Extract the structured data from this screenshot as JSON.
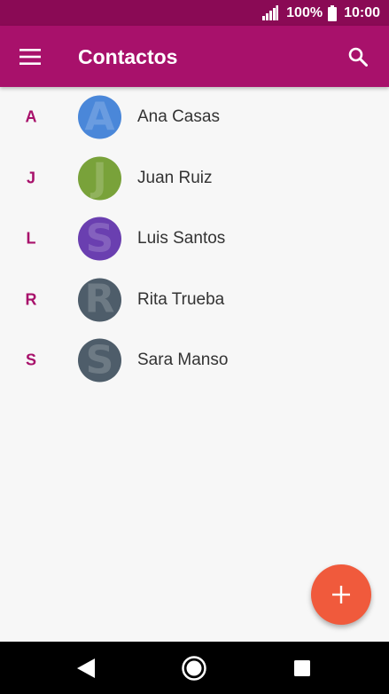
{
  "status_bar": {
    "battery_percent": "100%",
    "time": "10:00"
  },
  "app_bar": {
    "title": "Contactos",
    "menu_icon": "hamburger-menu-icon",
    "search_icon": "search-icon"
  },
  "contacts": [
    {
      "letter": "A",
      "name": "Ana Casas",
      "initial": "A",
      "color": "#4a87d9"
    },
    {
      "letter": "J",
      "name": "Juan Ruiz",
      "initial": "J",
      "color": "#79a23a"
    },
    {
      "letter": "L",
      "name": "Luis Santos",
      "initial": "S",
      "color": "#6a3fb0"
    },
    {
      "letter": "R",
      "name": "Rita Trueba",
      "initial": "R",
      "color": "#4e5d6a"
    },
    {
      "letter": "S",
      "name": "Sara Manso",
      "initial": "S",
      "color": "#4e5d6a"
    }
  ],
  "fab": {
    "icon": "add-icon",
    "color": "#f05a3c"
  },
  "colors": {
    "status_bar": "#8a0a55",
    "app_bar": "#a8116b",
    "accent": "#a8116b"
  },
  "nav_bar": {
    "back_icon": "back-icon",
    "home_icon": "home-icon",
    "recents_icon": "recents-icon"
  }
}
